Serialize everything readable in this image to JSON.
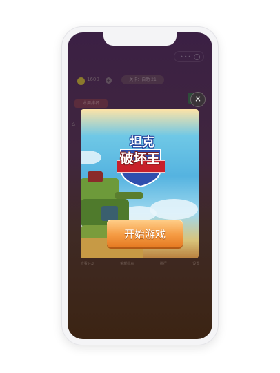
{
  "top_bar": {
    "coin_value": "1600",
    "level_text": "关卡：自助·21"
  },
  "side": {
    "tag_label": "本周排名"
  },
  "bottom_tabs": [
    "查看好友",
    "荣耀勋章",
    "排行",
    "设置"
  ],
  "popup": {
    "game_title_line1": "坦克",
    "game_title_line2": "破坏王",
    "start_button": "开始游戏",
    "close_symbol": "×"
  },
  "colors": {
    "accent": "#f59b43",
    "screen_bg": "#3b2044"
  }
}
